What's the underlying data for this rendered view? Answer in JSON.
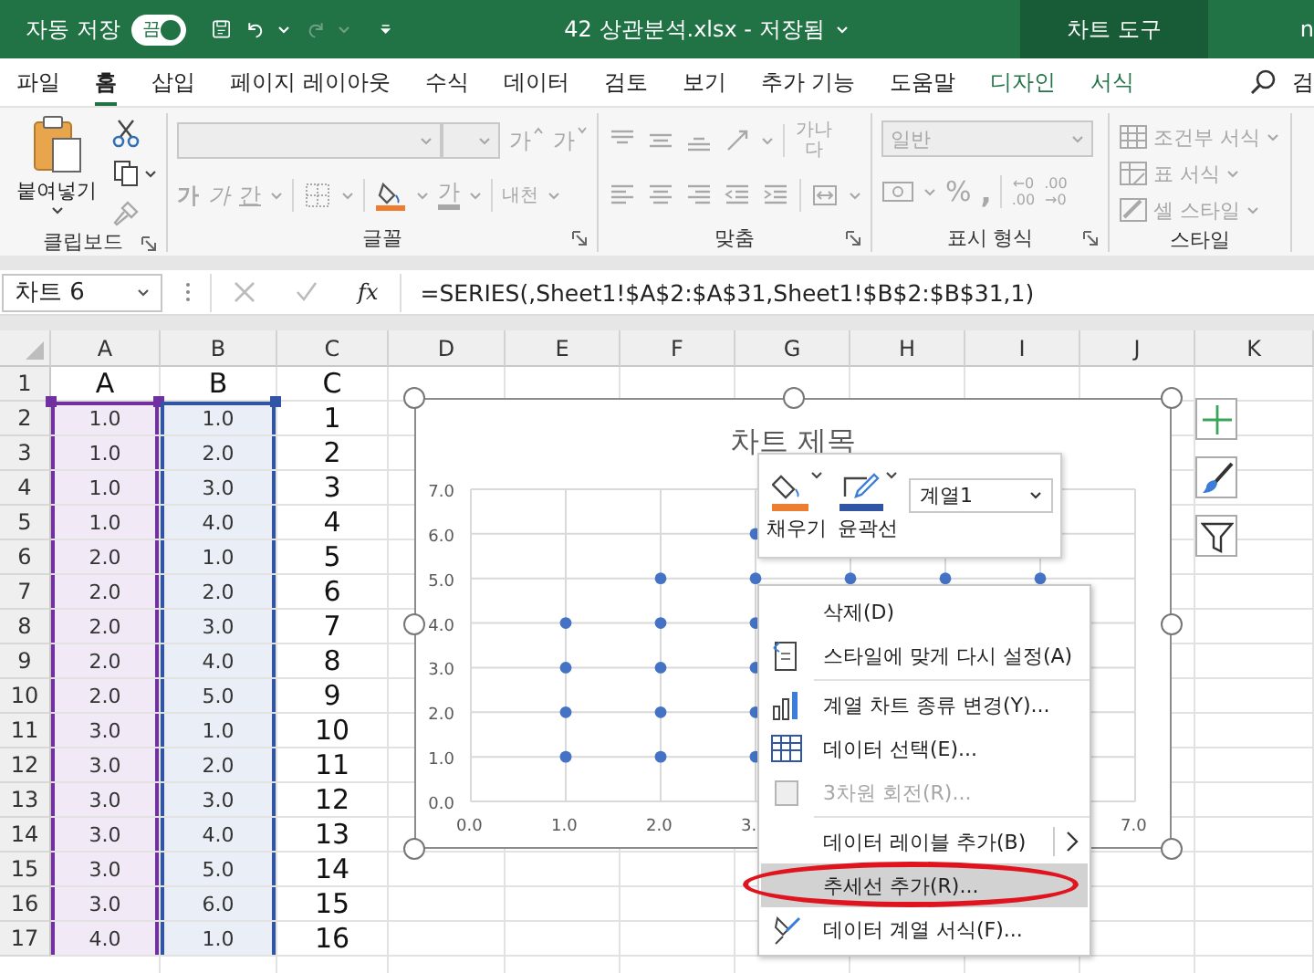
{
  "title_bar": {
    "autosave_label": "자동 저장",
    "autosave": {
      "label": "끔"
    },
    "document_title": "42 상관분석.xlsx - 저장됨",
    "context_group": "차트 도구",
    "account": "n"
  },
  "tabs": [
    {
      "label": "파일",
      "selected": false,
      "kind": "normal"
    },
    {
      "label": "홈",
      "selected": true,
      "kind": "normal"
    },
    {
      "label": "삽입",
      "selected": false,
      "kind": "normal"
    },
    {
      "label": "페이지 레이아웃",
      "selected": false,
      "kind": "normal"
    },
    {
      "label": "수식",
      "selected": false,
      "kind": "normal"
    },
    {
      "label": "데이터",
      "selected": false,
      "kind": "normal"
    },
    {
      "label": "검토",
      "selected": false,
      "kind": "normal"
    },
    {
      "label": "보기",
      "selected": false,
      "kind": "normal"
    },
    {
      "label": "추가 기능",
      "selected": false,
      "kind": "normal"
    },
    {
      "label": "도움말",
      "selected": false,
      "kind": "normal"
    },
    {
      "label": "디자인",
      "selected": false,
      "kind": "context"
    },
    {
      "label": "서식",
      "selected": false,
      "kind": "context"
    }
  ],
  "search_label": "검",
  "ribbon": [
    {
      "kind": "clipboard",
      "label": "클립보드",
      "disabled": false,
      "paste": "붙여넣기"
    },
    {
      "kind": "font",
      "label": "글꼴",
      "disabled": true,
      "grow": "가",
      "shrink": "가",
      "bold": "가",
      "italic": "가",
      "underline": "간",
      "font_color": "가",
      "phonetic": "내천"
    },
    {
      "kind": "alignment",
      "label": "맞춤",
      "disabled": true,
      "wrap": "가나다"
    },
    {
      "kind": "number",
      "label": "표시 형식",
      "disabled": true,
      "format": "일반",
      "percent": "%",
      "comma": ",",
      "decimal_left": [
        "←0",
        ".00"
      ],
      "decimal_right": [
        ".00",
        "→0"
      ]
    },
    {
      "kind": "styles",
      "label": "스타일",
      "disabled": true,
      "items": [
        "조건부 서식",
        "표 서식",
        "셀 스타일"
      ]
    }
  ],
  "formula_bar": {
    "name_box": "차트 6",
    "fx": "fx",
    "formula": "=SERIES(,Sheet1!$A$2:$A$31,Sheet1!$B$2:$B$31,1)"
  },
  "sheet": {
    "columns": [
      {
        "label": "A",
        "color": "#7030a0"
      },
      {
        "label": "B",
        "color": "#2f55a4"
      },
      {
        "label": "C"
      },
      {
        "label": "D"
      },
      {
        "label": "E"
      },
      {
        "label": "F"
      },
      {
        "label": "G"
      },
      {
        "label": "H"
      },
      {
        "label": "I"
      },
      {
        "label": "J"
      },
      {
        "label": "K"
      }
    ],
    "rows": [
      {
        "header": "1",
        "cells": [
          "A",
          "B",
          "C"
        ]
      },
      {
        "header": "2",
        "cells": [
          "1.0",
          "1.0",
          "1"
        ]
      },
      {
        "header": "3",
        "cells": [
          "1.0",
          "2.0",
          "2"
        ]
      },
      {
        "header": "4",
        "cells": [
          "1.0",
          "3.0",
          "3"
        ]
      },
      {
        "header": "5",
        "cells": [
          "1.0",
          "4.0",
          "4"
        ]
      },
      {
        "header": "6",
        "cells": [
          "2.0",
          "1.0",
          "5"
        ]
      },
      {
        "header": "7",
        "cells": [
          "2.0",
          "2.0",
          "6"
        ]
      },
      {
        "header": "8",
        "cells": [
          "2.0",
          "3.0",
          "7"
        ]
      },
      {
        "header": "9",
        "cells": [
          "2.0",
          "4.0",
          "8"
        ]
      },
      {
        "header": "10",
        "cells": [
          "2.0",
          "5.0",
          "9"
        ]
      },
      {
        "header": "11",
        "cells": [
          "3.0",
          "1.0",
          "10"
        ]
      },
      {
        "header": "12",
        "cells": [
          "3.0",
          "2.0",
          "11"
        ]
      },
      {
        "header": "13",
        "cells": [
          "3.0",
          "3.0",
          "12"
        ]
      },
      {
        "header": "14",
        "cells": [
          "3.0",
          "4.0",
          "13"
        ]
      },
      {
        "header": "15",
        "cells": [
          "3.0",
          "5.0",
          "14"
        ]
      },
      {
        "header": "16",
        "cells": [
          "3.0",
          "6.0",
          "15"
        ]
      },
      {
        "header": "17",
        "cells": [
          "4.0",
          "1.0",
          "16"
        ]
      }
    ]
  },
  "chart": {
    "chart_data": {
      "type": "scatter",
      "title": "차트 제목",
      "grid": true,
      "x": [
        1,
        1,
        1,
        1,
        2,
        2,
        2,
        2,
        2,
        3,
        3,
        3,
        3,
        3,
        3,
        4,
        5,
        6
      ],
      "series": [
        {
          "name": "계열1",
          "color": "#4472c4",
          "values": [
            1,
            2,
            3,
            4,
            1,
            2,
            3,
            4,
            5,
            1,
            2,
            3,
            4,
            5,
            6,
            5,
            5,
            5
          ]
        }
      ],
      "xlim": [
        0,
        7
      ],
      "ylim": [
        0,
        7
      ],
      "xticks": [
        {
          "value": 0,
          "label": "0.0"
        },
        {
          "value": 1,
          "label": "1.0"
        },
        {
          "value": 2,
          "label": "2.0"
        },
        {
          "value": 3,
          "label": "3."
        },
        {
          "value": 7,
          "label": "7.0"
        }
      ],
      "yticks": [
        {
          "value": 0,
          "label": "0.0"
        },
        {
          "value": 1,
          "label": "1.0"
        },
        {
          "value": 2,
          "label": "2.0"
        },
        {
          "value": 3,
          "label": "3.0"
        },
        {
          "value": 4,
          "label": "4.0"
        },
        {
          "value": 5,
          "label": "5.0"
        },
        {
          "value": 6,
          "label": "6.0"
        },
        {
          "value": 7,
          "label": "7.0"
        }
      ]
    }
  },
  "mini_toolbar": {
    "fill_label": "채우기",
    "outline_label": "윤곽선"
  },
  "context_menu": {
    "items": [
      {
        "kind": "item",
        "label": "삭제(D)",
        "disabled": false,
        "selected": false,
        "submenu": false,
        "circled": false
      },
      {
        "kind": "item",
        "label": "스타일에 맞게 다시 설정(A)",
        "disabled": false,
        "selected": false,
        "submenu": false,
        "circled": false
      },
      {
        "kind": "separator"
      },
      {
        "kind": "item",
        "label": "계열 차트 종류 변경(Y)...",
        "disabled": false,
        "selected": false,
        "submenu": false,
        "circled": false
      },
      {
        "kind": "item",
        "label": "데이터 선택(E)...",
        "disabled": false,
        "selected": false,
        "submenu": false,
        "circled": false
      },
      {
        "kind": "item",
        "label": "3차원 회전(R)...",
        "disabled": true,
        "selected": false,
        "submenu": false,
        "circled": false
      },
      {
        "kind": "separator"
      },
      {
        "kind": "item",
        "label": "데이터 레이블 추가(B)",
        "disabled": false,
        "selected": false,
        "submenu": true,
        "circled": false
      },
      {
        "kind": "item",
        "label": "추세선 추가(R)...",
        "disabled": false,
        "selected": true,
        "submenu": false,
        "circled": true
      },
      {
        "kind": "item",
        "label": "데이터 계열 서식(F)...",
        "disabled": false,
        "selected": false,
        "submenu": false,
        "circled": false
      }
    ]
  }
}
